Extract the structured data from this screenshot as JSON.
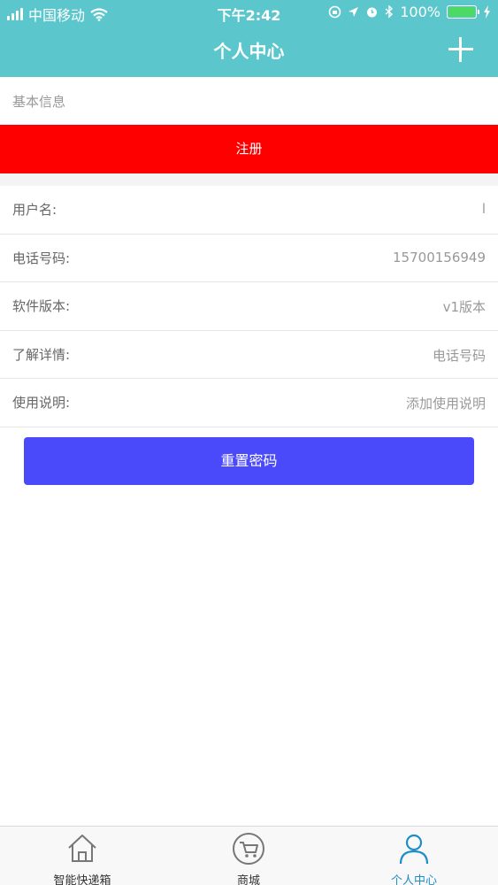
{
  "status_bar": {
    "carrier": "中国移动",
    "time": "下午2:42",
    "battery": "100%"
  },
  "nav": {
    "title": "个人中心"
  },
  "section_title": "基本信息",
  "register_label": "注册",
  "info_rows": [
    {
      "label": "用户名:",
      "value": "l"
    },
    {
      "label": "电话号码:",
      "value": "15700156949"
    },
    {
      "label": "软件版本:",
      "value": "v1版本"
    },
    {
      "label": "了解详情:",
      "value": "电话号码"
    },
    {
      "label": "使用说明:",
      "value": "添加使用说明"
    }
  ],
  "reset_password_label": "重置密码",
  "tabs": [
    {
      "label": "智能快递箱",
      "icon": "home-icon"
    },
    {
      "label": "商城",
      "icon": "cart-icon"
    },
    {
      "label": "个人中心",
      "icon": "user-icon",
      "active": true
    }
  ],
  "colors": {
    "header": "#5bc7cc",
    "register": "#ff0000",
    "reset_button": "#4a4afa",
    "tab_active": "#1e8fc6"
  }
}
